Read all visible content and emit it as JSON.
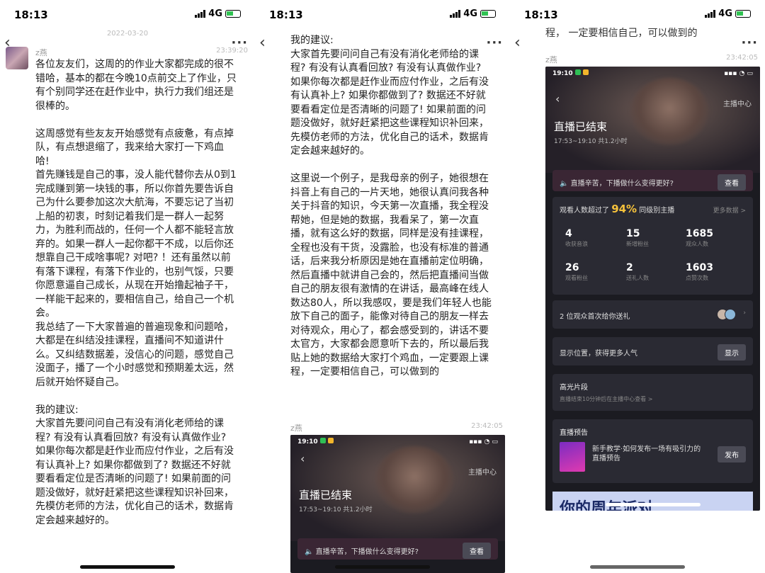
{
  "panels": [
    {
      "time": "18:13",
      "network": "4G",
      "date": "2022-03-20",
      "user": "z燕",
      "timestamp": "23:39:20",
      "message": "各位友友们，这周的的作业大家都完成的很不\n错哈，基本的都在今晚10点前交上了作业，只\n有个别同学还在赶作业中，执行力我们组还是\n很棒的。\n\n这周感觉有些友友开始感觉有点疲惫，有点掉\n队，有点想退缩了，我来给大家打一下鸡血\n哈!\n首先赚钱是自己的事，没人能代替你去从0到1\n完成赚到第一块钱的事，所以你首先要告诉自\n己为什么要参加这次大航海，不要忘记了当初\n上船的初衷，时刻记着我们是一群人一起努\n力，为胜利而战的，任何一个人都不能轻言放\n弃的。如果一群人一起你都干不成，以后你还\n想靠自己干成啥事呢? 对吧? ！还有虽然以前\n有落下课程，有落下作业的，也别气馁，只要\n你愿意逼自己成长，从现在开始撸起袖子干，\n一样能干起来的，要相信自己，给自己一个机\n会。\n我总结了一下大家普遍的普遍现象和问题哈，\n大都是在纠结没挂课程，直播间不知道讲什\n么。又纠结数据差，没信心的问题，感觉自己\n没面子，播了一个小时感觉和预期差太远，然\n后就开始怀疑自己。\n\n我的建议:\n大家首先要问问自己有没有消化老师给的课\n程? 有没有认真看回放? 有没有认真做作业?\n如果你每次都是赶作业而应付作业，之后有没\n有认真补上? 如果你都做到了? 数据还不好就\n要看看定位是否清晰的问题了! 如果前面的问\n题没做好，就好赶紧把这些课程知识补回来，\n先模仿老师的方法，优化自己的话术，数据肯\n定会越来越好的。"
    },
    {
      "time": "18:13",
      "network": "4G",
      "message": "我的建议:\n大家首先要问问自己有没有消化老师给的课\n程? 有没有认真看回放? 有没有认真做作业?\n如果你每次都是赶作业而应付作业，之后有没\n有认真补上? 如果你都做到了? 数据还不好就\n要看看定位是否清晰的问题了! 如果前面的问\n题没做好，就好赶紧把这些课程知识补回来，\n先模仿老师的方法，优化自己的话术，数据肯\n定会越来越好的。\n\n这里说一个例子，是我母亲的例子，她很想在\n抖音上有自己的一片天地，她很认真问我各种\n关于抖音的知识，今天第一次直播，我全程没\n帮她，但是她的数据，我看呆了，第一次直\n播，就有这么好的数据，同样是没有挂课程，\n全程也没有干货，没露脸，也没有标准的普通\n话，后来我分析原因是她在直播前定位明确，\n然后直播中就讲自己会的，然后把直播间当做\n自己的朋友很有激情的在讲话，最高峰在线人\n数达80人，所以我感叹，要是我们年轻人也能\n放下自己的面子，能像对待自己的朋友一样去\n对待观众，用心了，都会感受到的，讲话不要\n太官方，大家都会愿意听下去的，所以最后我\n贴上她的数据给大家打个鸡血，一定要跟上课\n程，一定要相信自己，可以做到的",
      "user": "z燕",
      "timestamp": "23:42:05"
    },
    {
      "time": "18:13",
      "network": "4G",
      "cut_text": "程，  一定要相信自己，可以做到的",
      "user": "z燕",
      "timestamp": "23:42:05"
    }
  ],
  "live_stats": {
    "inner_time": "19:10",
    "center": "主播中心",
    "title": "直播已结束",
    "subtitle": "17:53~19:10 共1.2小时",
    "tip": "直播辛苦，下播做什么变得更好?",
    "tip_btn": "查看",
    "rank_prefix": "观看人数超过了",
    "rank_pct": "94%",
    "rank_suffix": "同级别主播",
    "more_data": "更多数据 >",
    "stats": [
      {
        "value": "4",
        "label": "收获音浪"
      },
      {
        "value": "15",
        "label": "新增粉丝"
      },
      {
        "value": "1685",
        "label": "观众人数"
      },
      {
        "value": "26",
        "label": "观看粉丝"
      },
      {
        "value": "2",
        "label": "送礼人数"
      },
      {
        "value": "1603",
        "label": "点赞次数"
      }
    ],
    "gift_text": "2 位观众首次给你送礼",
    "position_text": "显示位置，获得更多人气",
    "position_btn": "显示",
    "highlight_title": "高光片段",
    "highlight_sub": "直播结束10分钟后在主播中心查看 >",
    "preview_title": "直播预告",
    "preview_desc": "新手教学·如何发布一场有吸引力的直播预告",
    "preview_btn": "发布",
    "promo": "你的周年派对"
  }
}
